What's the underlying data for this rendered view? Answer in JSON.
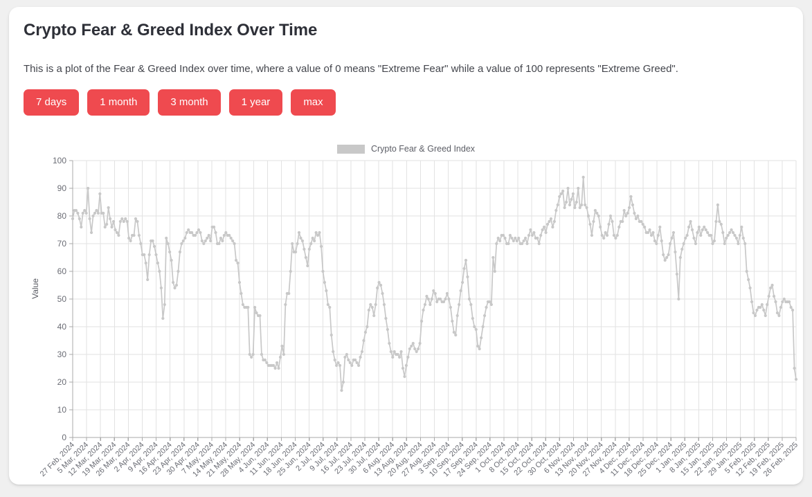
{
  "header": {
    "title": "Crypto Fear & Greed Index Over Time",
    "subtitle": "This is a plot of the Fear & Greed Index over time, where a value of 0 means \"Extreme Fear\" while a value of 100 represents \"Extreme Greed\"."
  },
  "range_buttons": [
    {
      "label": "7 days"
    },
    {
      "label": "1 month"
    },
    {
      "label": "3 month"
    },
    {
      "label": "1 year"
    },
    {
      "label": "max"
    }
  ],
  "colors": {
    "accent": "#ef4a4f",
    "series": "#c8c8c8",
    "grid": "#e2e2e2",
    "axis": "#a8a8a8",
    "card": "#ffffff",
    "page_background": "#f0f0f0",
    "title_text": "#2e3038",
    "tick_text": "#6a6c74"
  },
  "chart_data": {
    "type": "line",
    "title": "",
    "xlabel": "",
    "ylabel": "Value",
    "ylim": [
      0,
      100
    ],
    "ytick_step": 10,
    "yticks": [
      0,
      10,
      20,
      30,
      40,
      50,
      60,
      70,
      80,
      90,
      100
    ],
    "grid": true,
    "legend_position": "top-center",
    "marker": "circle",
    "legend": [
      "Crypto Fear & Greed Index"
    ],
    "series": [
      {
        "name": "Crypto Fear & Greed Index",
        "color": "#c8c8c8",
        "start_date": "27 Feb, 2024",
        "end_date": "26 Feb, 2025",
        "interval": "daily",
        "min": 17,
        "max": 94,
        "values": [
          79,
          82,
          82,
          81,
          79,
          76,
          81,
          82,
          81,
          90,
          79,
          74,
          80,
          81,
          82,
          81,
          88,
          81,
          81,
          76,
          77,
          83,
          79,
          76,
          78,
          75,
          74,
          73,
          78,
          79,
          78,
          79,
          78,
          72,
          71,
          73,
          73,
          79,
          78,
          73,
          70,
          66,
          66,
          63,
          57,
          66,
          71,
          71,
          69,
          66,
          63,
          60,
          54,
          43,
          48,
          72,
          70,
          67,
          64,
          56,
          54,
          55,
          60,
          67,
          70,
          71,
          72,
          74,
          75,
          74,
          74,
          73,
          73,
          74,
          75,
          74,
          71,
          70,
          71,
          72,
          73,
          71,
          76,
          76,
          74,
          70,
          70,
          72,
          71,
          73,
          74,
          73,
          73,
          72,
          71,
          70,
          64,
          63,
          56,
          52,
          48,
          47,
          47,
          47,
          30,
          29,
          30,
          47,
          45,
          44,
          44,
          30,
          28,
          28,
          27,
          26,
          26,
          26,
          26,
          25,
          27,
          25,
          29,
          33,
          30,
          48,
          52,
          52,
          60,
          70,
          67,
          67,
          70,
          74,
          72,
          71,
          68,
          65,
          62,
          68,
          70,
          72,
          71,
          74,
          73,
          74,
          69,
          60,
          56,
          53,
          48,
          47,
          37,
          31,
          28,
          26,
          27,
          26,
          17,
          20,
          29,
          30,
          28,
          27,
          26,
          28,
          28,
          27,
          26,
          29,
          31,
          35,
          38,
          40,
          46,
          48,
          47,
          44,
          48,
          54,
          56,
          55,
          52,
          48,
          43,
          39,
          34,
          31,
          29,
          31,
          30,
          30,
          29,
          31,
          25,
          22,
          26,
          29,
          32,
          33,
          34,
          32,
          31,
          32,
          34,
          42,
          46,
          48,
          51,
          50,
          48,
          50,
          53,
          52,
          49,
          50,
          50,
          49,
          49,
          50,
          52,
          50,
          47,
          42,
          38,
          37,
          44,
          48,
          53,
          56,
          61,
          64,
          58,
          50,
          48,
          43,
          40,
          39,
          33,
          32,
          36,
          40,
          44,
          47,
          49,
          49,
          48,
          65,
          60,
          70,
          72,
          71,
          73,
          73,
          72,
          70,
          70,
          73,
          72,
          71,
          72,
          71,
          72,
          70,
          70,
          71,
          72,
          70,
          73,
          75,
          73,
          74,
          72,
          72,
          70,
          73,
          75,
          76,
          74,
          77,
          78,
          79,
          76,
          78,
          82,
          84,
          87,
          88,
          89,
          83,
          85,
          90,
          84,
          86,
          88,
          83,
          85,
          90,
          83,
          84,
          94,
          84,
          83,
          80,
          77,
          73,
          78,
          82,
          81,
          80,
          76,
          73,
          72,
          74,
          73,
          77,
          80,
          78,
          73,
          72,
          73,
          76,
          78,
          78,
          82,
          80,
          81,
          83,
          87,
          84,
          81,
          79,
          80,
          78,
          78,
          77,
          76,
          74,
          74,
          75,
          73,
          74,
          71,
          70,
          73,
          76,
          71,
          66,
          64,
          65,
          66,
          70,
          72,
          74,
          67,
          59,
          50,
          65,
          68,
          70,
          72,
          73,
          76,
          78,
          75,
          72,
          70,
          74,
          76,
          73,
          75,
          76,
          75,
          74,
          73,
          73,
          70,
          71,
          78,
          84,
          78,
          77,
          74,
          70,
          72,
          73,
          74,
          75,
          74,
          73,
          72,
          70,
          73,
          76,
          72,
          70,
          60,
          57,
          54,
          49,
          45,
          44,
          46,
          47,
          47,
          48,
          46,
          44,
          48,
          51,
          54,
          55,
          51,
          49,
          45,
          44,
          47,
          49,
          50,
          49,
          49,
          49,
          47,
          46,
          25,
          21
        ]
      }
    ],
    "xticks": [
      "27 Feb, 2024",
      "5 Mar, 2024",
      "12 Mar, 2024",
      "19 Mar, 2024",
      "26 Mar, 2024",
      "2 Apr, 2024",
      "9 Apr, 2024",
      "16 Apr, 2024",
      "23 Apr, 2024",
      "30 Apr, 2024",
      "7 May, 2024",
      "14 May, 2024",
      "21 May, 2024",
      "28 May, 2024",
      "4 Jun, 2024",
      "11 Jun, 2024",
      "18 Jun, 2024",
      "25 Jun, 2024",
      "2 Jul, 2024",
      "9 Jul, 2024",
      "16 Jul, 2024",
      "23 Jul, 2024",
      "30 Jul, 2024",
      "6 Aug, 2024",
      "13 Aug, 2024",
      "20 Aug, 2024",
      "27 Aug, 2024",
      "3 Sep, 2024",
      "10 Sep, 2024",
      "17 Sep, 2024",
      "24 Sep, 2024",
      "1 Oct, 2024",
      "8 Oct, 2024",
      "15 Oct, 2024",
      "22 Oct, 2024",
      "30 Oct, 2024",
      "6 Nov, 2024",
      "13 Nov, 2024",
      "20 Nov, 2024",
      "27 Nov, 2024",
      "4 Dec, 2024",
      "11 Dec, 2024",
      "18 Dec, 2024",
      "25 Dec, 2024",
      "1 Jan, 2025",
      "8 Jan, 2025",
      "15 Jan, 2025",
      "22 Jan, 2025",
      "29 Jan, 2025",
      "5 Feb, 2025",
      "12 Feb, 2025",
      "19 Feb, 2025",
      "26 Feb, 2025"
    ]
  }
}
